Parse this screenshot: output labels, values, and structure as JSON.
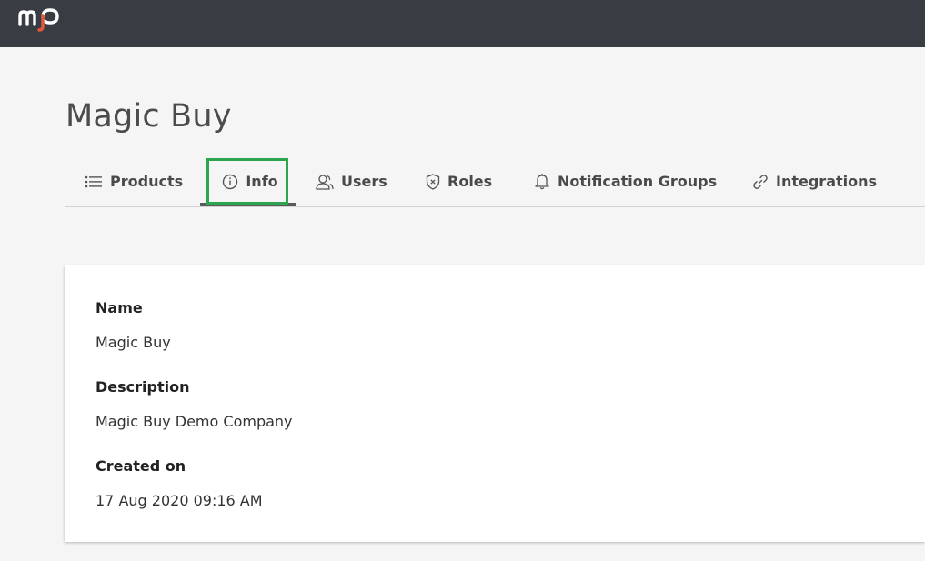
{
  "app": {
    "logo_text": "mp"
  },
  "page": {
    "title": "Magic Buy"
  },
  "tabs": [
    {
      "label": "Products",
      "icon": "list-icon"
    },
    {
      "label": "Info",
      "icon": "info-icon",
      "active": true
    },
    {
      "label": "Users",
      "icon": "users-icon"
    },
    {
      "label": "Roles",
      "icon": "shield-icon"
    },
    {
      "label": "Notification Groups",
      "icon": "bell-icon"
    },
    {
      "label": "Integrations",
      "icon": "link-icon"
    }
  ],
  "info": {
    "fields": [
      {
        "label": "Name",
        "value": "Magic Buy"
      },
      {
        "label": "Description",
        "value": "Magic Buy Demo Company"
      },
      {
        "label": "Created on",
        "value": "17 Aug 2020 09:16 AM"
      }
    ]
  },
  "colors": {
    "topbar": "#383d43",
    "logo_accent": "#e8553e",
    "highlight": "#2da44e",
    "active_underline": "#5a5a5a"
  }
}
